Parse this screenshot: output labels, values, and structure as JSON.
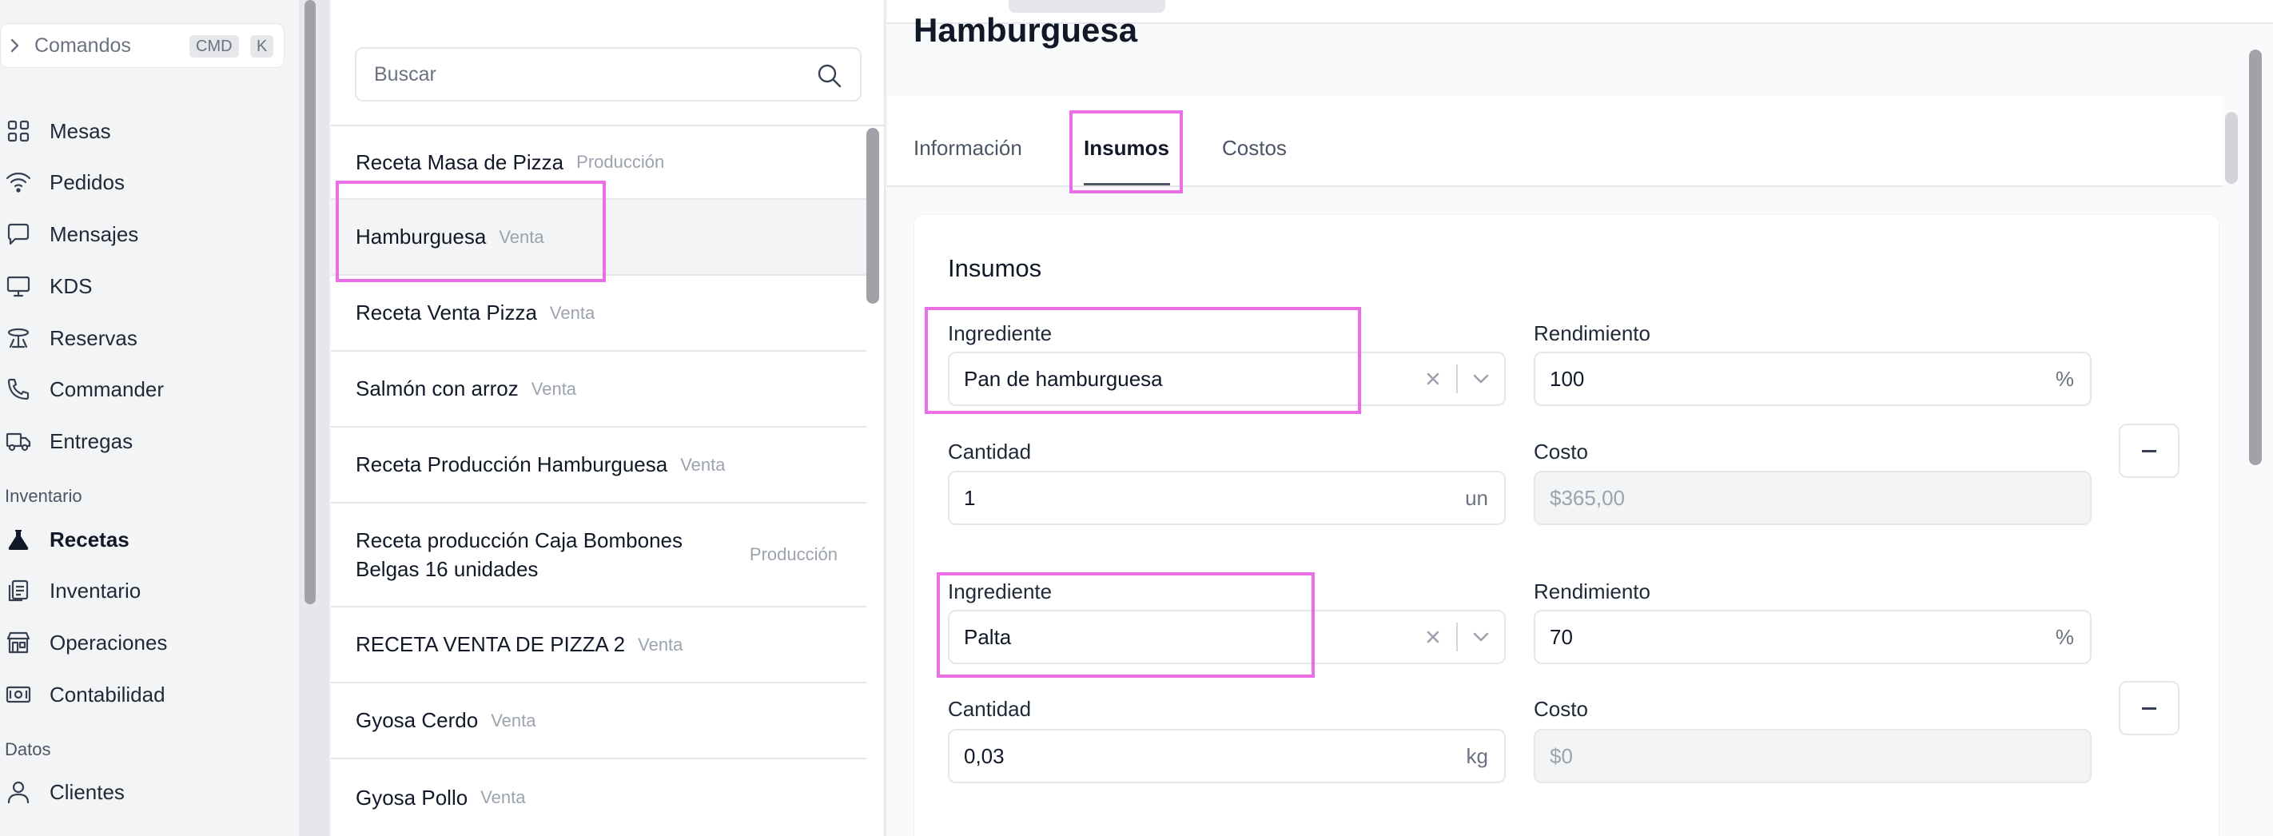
{
  "sidebar": {
    "command": {
      "label": "Comandos",
      "key1": "CMD",
      "key2": "K"
    },
    "items": [
      {
        "label": "Mesas",
        "icon": "grid-icon"
      },
      {
        "label": "Pedidos",
        "icon": "wifi-icon"
      },
      {
        "label": "Mensajes",
        "icon": "chat-icon"
      },
      {
        "label": "KDS",
        "icon": "monitor-icon"
      },
      {
        "label": "Reservas",
        "icon": "table-icon"
      },
      {
        "label": "Commander",
        "icon": "phone-icon"
      },
      {
        "label": "Entregas",
        "icon": "truck-icon"
      }
    ],
    "section_inventario": "Inventario",
    "inventario_items": [
      {
        "label": "Recetas",
        "icon": "flask-icon"
      },
      {
        "label": "Inventario",
        "icon": "clipboard-icon"
      },
      {
        "label": "Operaciones",
        "icon": "store-icon"
      },
      {
        "label": "Contabilidad",
        "icon": "cash-icon"
      }
    ],
    "section_datos": "Datos",
    "datos_items": [
      {
        "label": "Clientes",
        "icon": "user-icon"
      }
    ]
  },
  "list": {
    "search_placeholder": "Buscar",
    "rows": [
      {
        "name": "Receta Masa de Pizza",
        "tag": "Producción"
      },
      {
        "name": "Hamburguesa",
        "tag": "Venta"
      },
      {
        "name": "Receta Venta Pizza",
        "tag": "Venta"
      },
      {
        "name": "Salmón con arroz",
        "tag": "Venta"
      },
      {
        "name": "Receta Producción Hamburguesa",
        "tag": "Venta"
      },
      {
        "name": "Receta producción Caja Bombones Belgas 16 unidades",
        "tag": "Producción"
      },
      {
        "name": "RECETA VENTA DE PIZZA 2",
        "tag": "Venta"
      },
      {
        "name": "Gyosa Cerdo",
        "tag": "Venta"
      },
      {
        "name": "Gyosa Pollo",
        "tag": "Venta"
      }
    ]
  },
  "detail": {
    "title": "Hamburguesa",
    "tabs": [
      "Información",
      "Insumos",
      "Costos"
    ],
    "card_title": "Insumos",
    "labels": {
      "ingrediente": "Ingrediente",
      "rendimiento": "Rendimiento",
      "cantidad": "Cantidad",
      "costo": "Costo"
    },
    "insumos": [
      {
        "ingrediente": "Pan de hamburguesa",
        "rendimiento": "100",
        "rend_unit": "%",
        "cantidad": "1",
        "cant_unit": "un",
        "costo": "$365,00"
      },
      {
        "ingrediente": "Palta",
        "rendimiento": "70",
        "rend_unit": "%",
        "cantidad": "0,03",
        "cant_unit": "kg",
        "costo": "$0"
      }
    ]
  },
  "colors": {
    "highlight": "#ec6ee6",
    "muted": "#9ca3af"
  }
}
